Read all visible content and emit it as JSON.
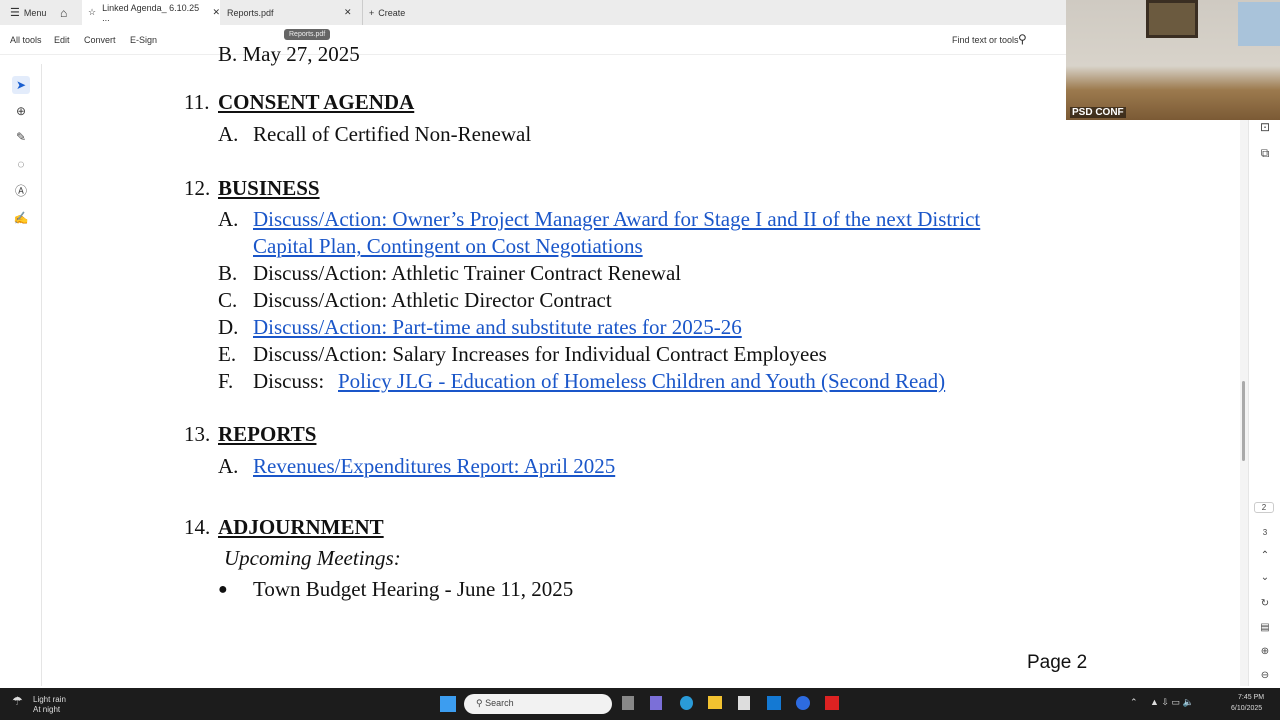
{
  "tabs": {
    "menu": "Menu",
    "active": "Linked Agenda_ 6.10.25 ...",
    "second": "Reports.pdf",
    "create": "Create",
    "tooltip": "Reports.pdf"
  },
  "toolbar": {
    "all_tools": "All tools",
    "edit": "Edit",
    "convert": "Convert",
    "esign": "E-Sign",
    "find": "Find text or tools"
  },
  "video": {
    "label": "PSD CONF"
  },
  "doc": {
    "prev_line": "B.  May 27, 2025",
    "s11": {
      "num": "11.",
      "title": "CONSENT AGENDA",
      "items": [
        {
          "l": "A.",
          "t": "Recall of Certified Non-Renewal"
        }
      ]
    },
    "s12": {
      "num": "12.",
      "title": "BUSINESS",
      "a": {
        "l": "A.",
        "t1": "Discuss/Action: Owner’s Project Manager Award for Stage I and II of the next District",
        "t2": "Capital Plan, Contingent on Cost Negotiations"
      },
      "b": {
        "l": "B.",
        "t": "Discuss/Action: Athletic Trainer Contract Renewal"
      },
      "c": {
        "l": "C.",
        "t": "Discuss/Action: Athletic Director Contract"
      },
      "d": {
        "l": "D.",
        "t": "Discuss/Action: Part-time and substitute rates for 2025-26"
      },
      "e": {
        "l": "E.",
        "t": "Discuss/Action: Salary Increases for Individual Contract Employees"
      },
      "f": {
        "l": "F.",
        "pre": "Discuss: ",
        "t": "Policy JLG - Education of Homeless Children and Youth (Second Read)"
      }
    },
    "s13": {
      "num": "13.",
      "title": "REPORTS",
      "a": {
        "l": "A.",
        "t": "Revenues/Expenditures Report: April 2025"
      }
    },
    "s14": {
      "num": "14.",
      "title": "ADJOURNMENT",
      "upcoming": "Upcoming Meetings:",
      "bullet": "●",
      "item": "Town Budget Hearing - June 11, 2025"
    },
    "page_label": "Page 2"
  },
  "rail": {
    "page_current": "2",
    "page_next": "3"
  },
  "taskbar": {
    "weather1": "Light rain",
    "weather2": "At night",
    "search": "Search",
    "time": "7:45 PM",
    "date": "6/10/2025"
  },
  "colors": {
    "link": "#1a56c9",
    "accent": "#1a5fd0"
  }
}
